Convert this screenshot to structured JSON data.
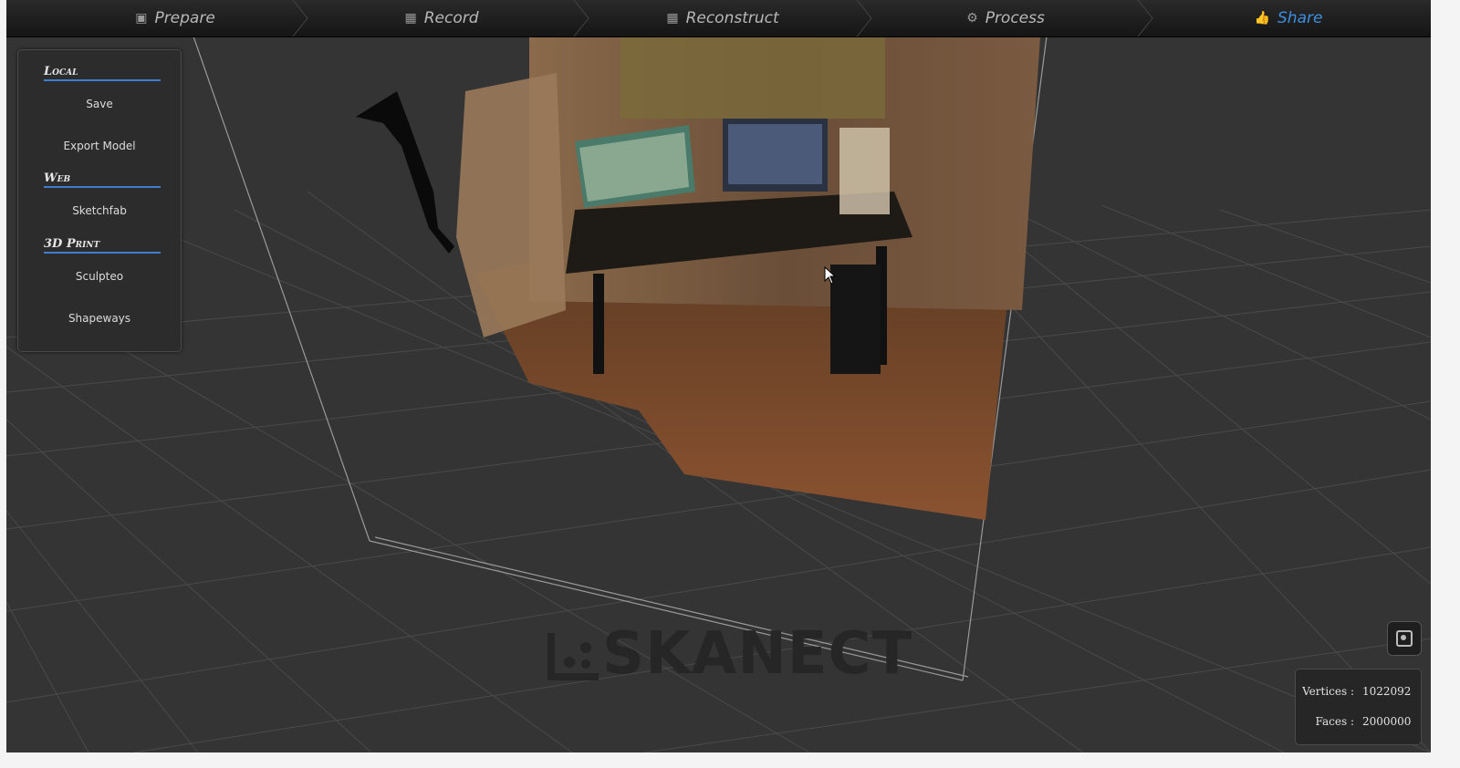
{
  "steps": [
    {
      "label": "Prepare",
      "icon": "prepare-icon"
    },
    {
      "label": "Record",
      "icon": "film-icon"
    },
    {
      "label": "Reconstruct",
      "icon": "film-icon"
    },
    {
      "label": "Process",
      "icon": "gears-icon"
    },
    {
      "label": "Share",
      "icon": "thumbs-up-icon",
      "active": true
    }
  ],
  "panel": {
    "local_title": "Local",
    "save": "Save",
    "export": "Export Model",
    "web_title": "Web",
    "sketchfab": "Sketchfab",
    "print_title": "3D Print",
    "sculpteo": "Sculpteo",
    "shapeways": "Shapeways"
  },
  "logo": "SKANECT",
  "stats": {
    "vertices_label": "Vertices :",
    "vertices": "1022092",
    "faces_label": "Faces :",
    "faces": "2000000"
  },
  "colors": {
    "accent": "#3c8fe0",
    "background": "#343434",
    "panel": "#2c2c2c"
  }
}
